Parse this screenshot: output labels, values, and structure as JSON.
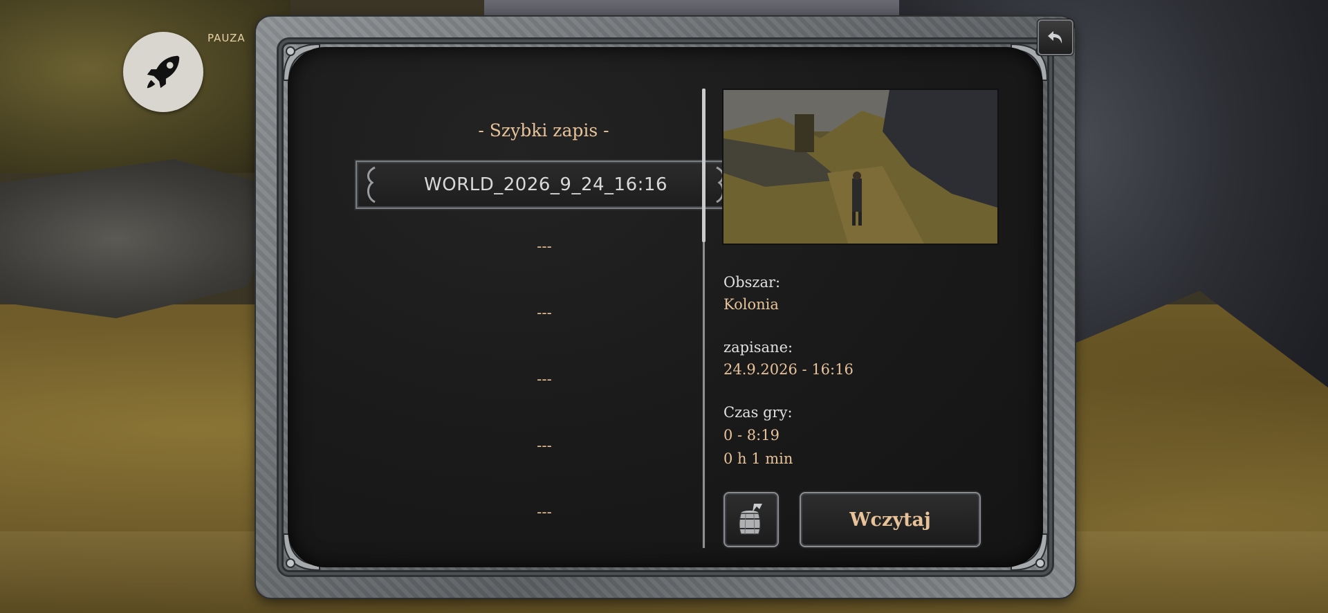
{
  "hud": {
    "pause_label": "PAUZA",
    "rocket_icon": "rocket-icon",
    "back_icon": "return-arrow-icon"
  },
  "save_list": {
    "title": "- Szybki zapis -",
    "selected_save": "WORLD_2026_9_24_16:16",
    "empty_slots": [
      "---",
      "---",
      "---",
      "---",
      "---"
    ]
  },
  "details": {
    "area_label": "Obszar:",
    "area_value": "Kolonia",
    "saved_label": "zapisane:",
    "saved_value": "24.9.2026 - 16:16",
    "playtime_label": "Czas gry:",
    "playtime_value_1": "0 - 8:19",
    "playtime_value_2": "0 h 1 min"
  },
  "actions": {
    "delete_icon": "barrel-icon",
    "load_label": "Wczytaj"
  },
  "colors": {
    "accent": "#e8c39a",
    "text": "#d9d9d9",
    "panel": "#1a1a1a",
    "frame": "#6d7174"
  }
}
